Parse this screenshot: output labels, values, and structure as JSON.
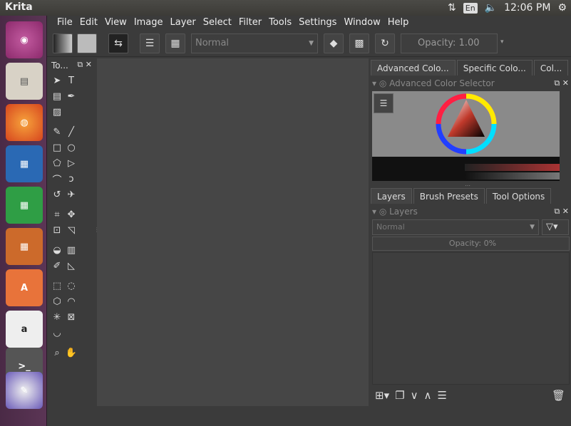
{
  "app": {
    "title": "Krita"
  },
  "menu": [
    "File",
    "Edit",
    "View",
    "Image",
    "Layer",
    "Select",
    "Filter",
    "Tools",
    "Settings",
    "Window",
    "Help"
  ],
  "tray": {
    "lang": "En",
    "time": "12:06 PM"
  },
  "toolbar": {
    "blend_mode": "Normal",
    "opacity": "Opacity:  1.00"
  },
  "toolbox": {
    "title": "To..."
  },
  "dock": {
    "top_tabs": [
      "Advanced Colo...",
      "Specific Colo...",
      "Col..."
    ],
    "color_selector_title": "Advanced Color Selector",
    "bottom_tabs": [
      "Layers",
      "Brush Presets",
      "Tool Options"
    ],
    "layers_title": "Layers",
    "layers_blend": "Normal",
    "layers_opacity": "Opacity:  0%"
  },
  "colors": {
    "accent": "#e8733a",
    "launcher": "#4f2c4a"
  }
}
